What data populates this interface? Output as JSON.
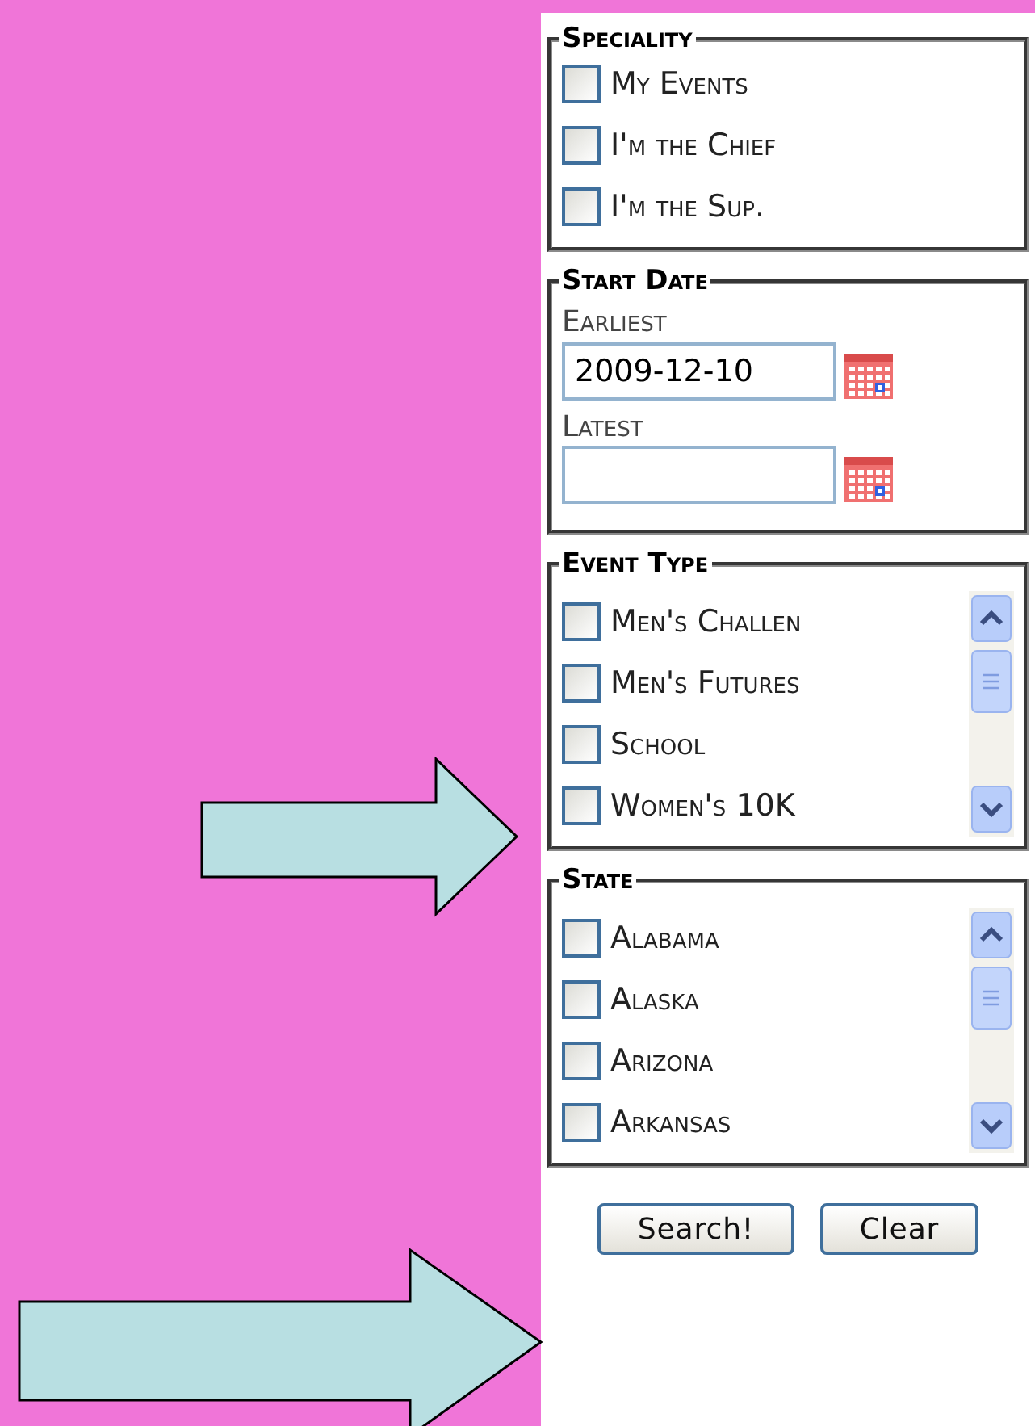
{
  "speciality": {
    "legend": "Speciality",
    "options": [
      {
        "label": "My Events",
        "checked": false
      },
      {
        "label": "I'm the Chief",
        "checked": false
      },
      {
        "label": "I'm the Sup.",
        "checked": false
      }
    ]
  },
  "start_date": {
    "legend": "Start Date",
    "fields": [
      {
        "label": "Earliest",
        "value": "2009-12-10"
      },
      {
        "label": "Latest"
      }
    ]
  },
  "event_type": {
    "legend": "Event Type",
    "options": [
      {
        "label": "Men's Challen",
        "checked": false
      },
      {
        "label": "Men's Futures",
        "checked": false
      },
      {
        "label": "School",
        "checked": false
      },
      {
        "label": "Women's 10K",
        "checked": false
      }
    ]
  },
  "state": {
    "legend": "State",
    "options": [
      {
        "label": "Alabama",
        "checked": false
      },
      {
        "label": "Alaska",
        "checked": false
      },
      {
        "label": "Arizona",
        "checked": false
      },
      {
        "label": "Arkansas",
        "checked": false
      }
    ]
  },
  "buttons": [
    "Search!",
    "Clear"
  ]
}
